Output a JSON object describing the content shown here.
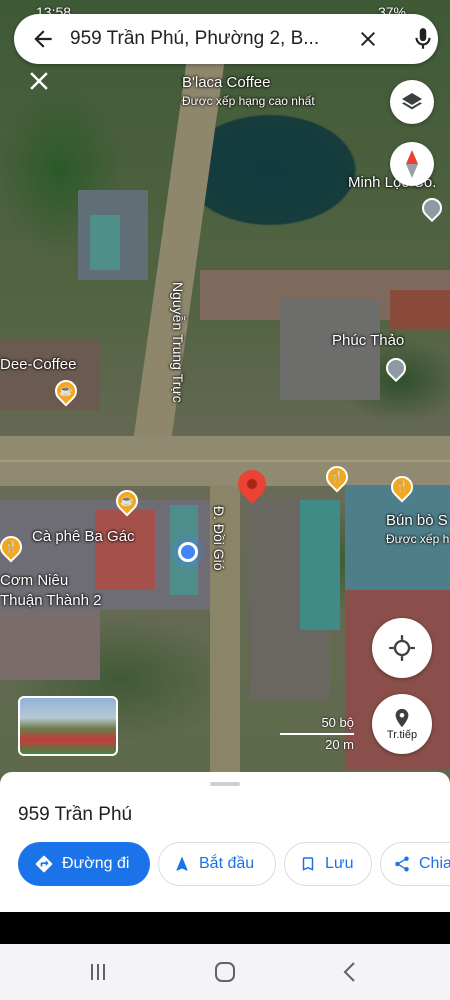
{
  "status_bar": {
    "time": "13:58",
    "battery": "37%"
  },
  "search": {
    "query": "959 Trần Phú, Phường 2, B..."
  },
  "map": {
    "labels": {
      "blaca": "B'laca Coffee",
      "blaca_sub": "Được xếp hạng cao nhất",
      "minh_loc": "Minh Lộc Co.",
      "street_nguyen": "Nguyễn Trung Trực",
      "dee_coffee": "Dee-Coffee",
      "phuc_thao": "Phúc Thảo",
      "ca_phe": "Cà phê Ba Gác",
      "com_nieu": "Cơm Niêu",
      "thuan_thanh": "Thuận Thành 2",
      "street_doi_gio": "Đ. Đồi Gió",
      "bun_bo": "Bún bò S",
      "bun_bo_sub": "Được xếp h"
    },
    "scale": {
      "top": "50 bộ",
      "bottom": "20 m"
    },
    "directions_fab_label": "Tr.tiếp"
  },
  "sheet": {
    "place_name": "959 Trần Phú",
    "actions": {
      "directions": "Đường đi",
      "start": "Bắt đầu",
      "save": "Lưu",
      "share": "Chia"
    }
  },
  "colors": {
    "accent": "#1a73e8",
    "pin": "#ea4335",
    "food_pin": "#f2a81d"
  }
}
